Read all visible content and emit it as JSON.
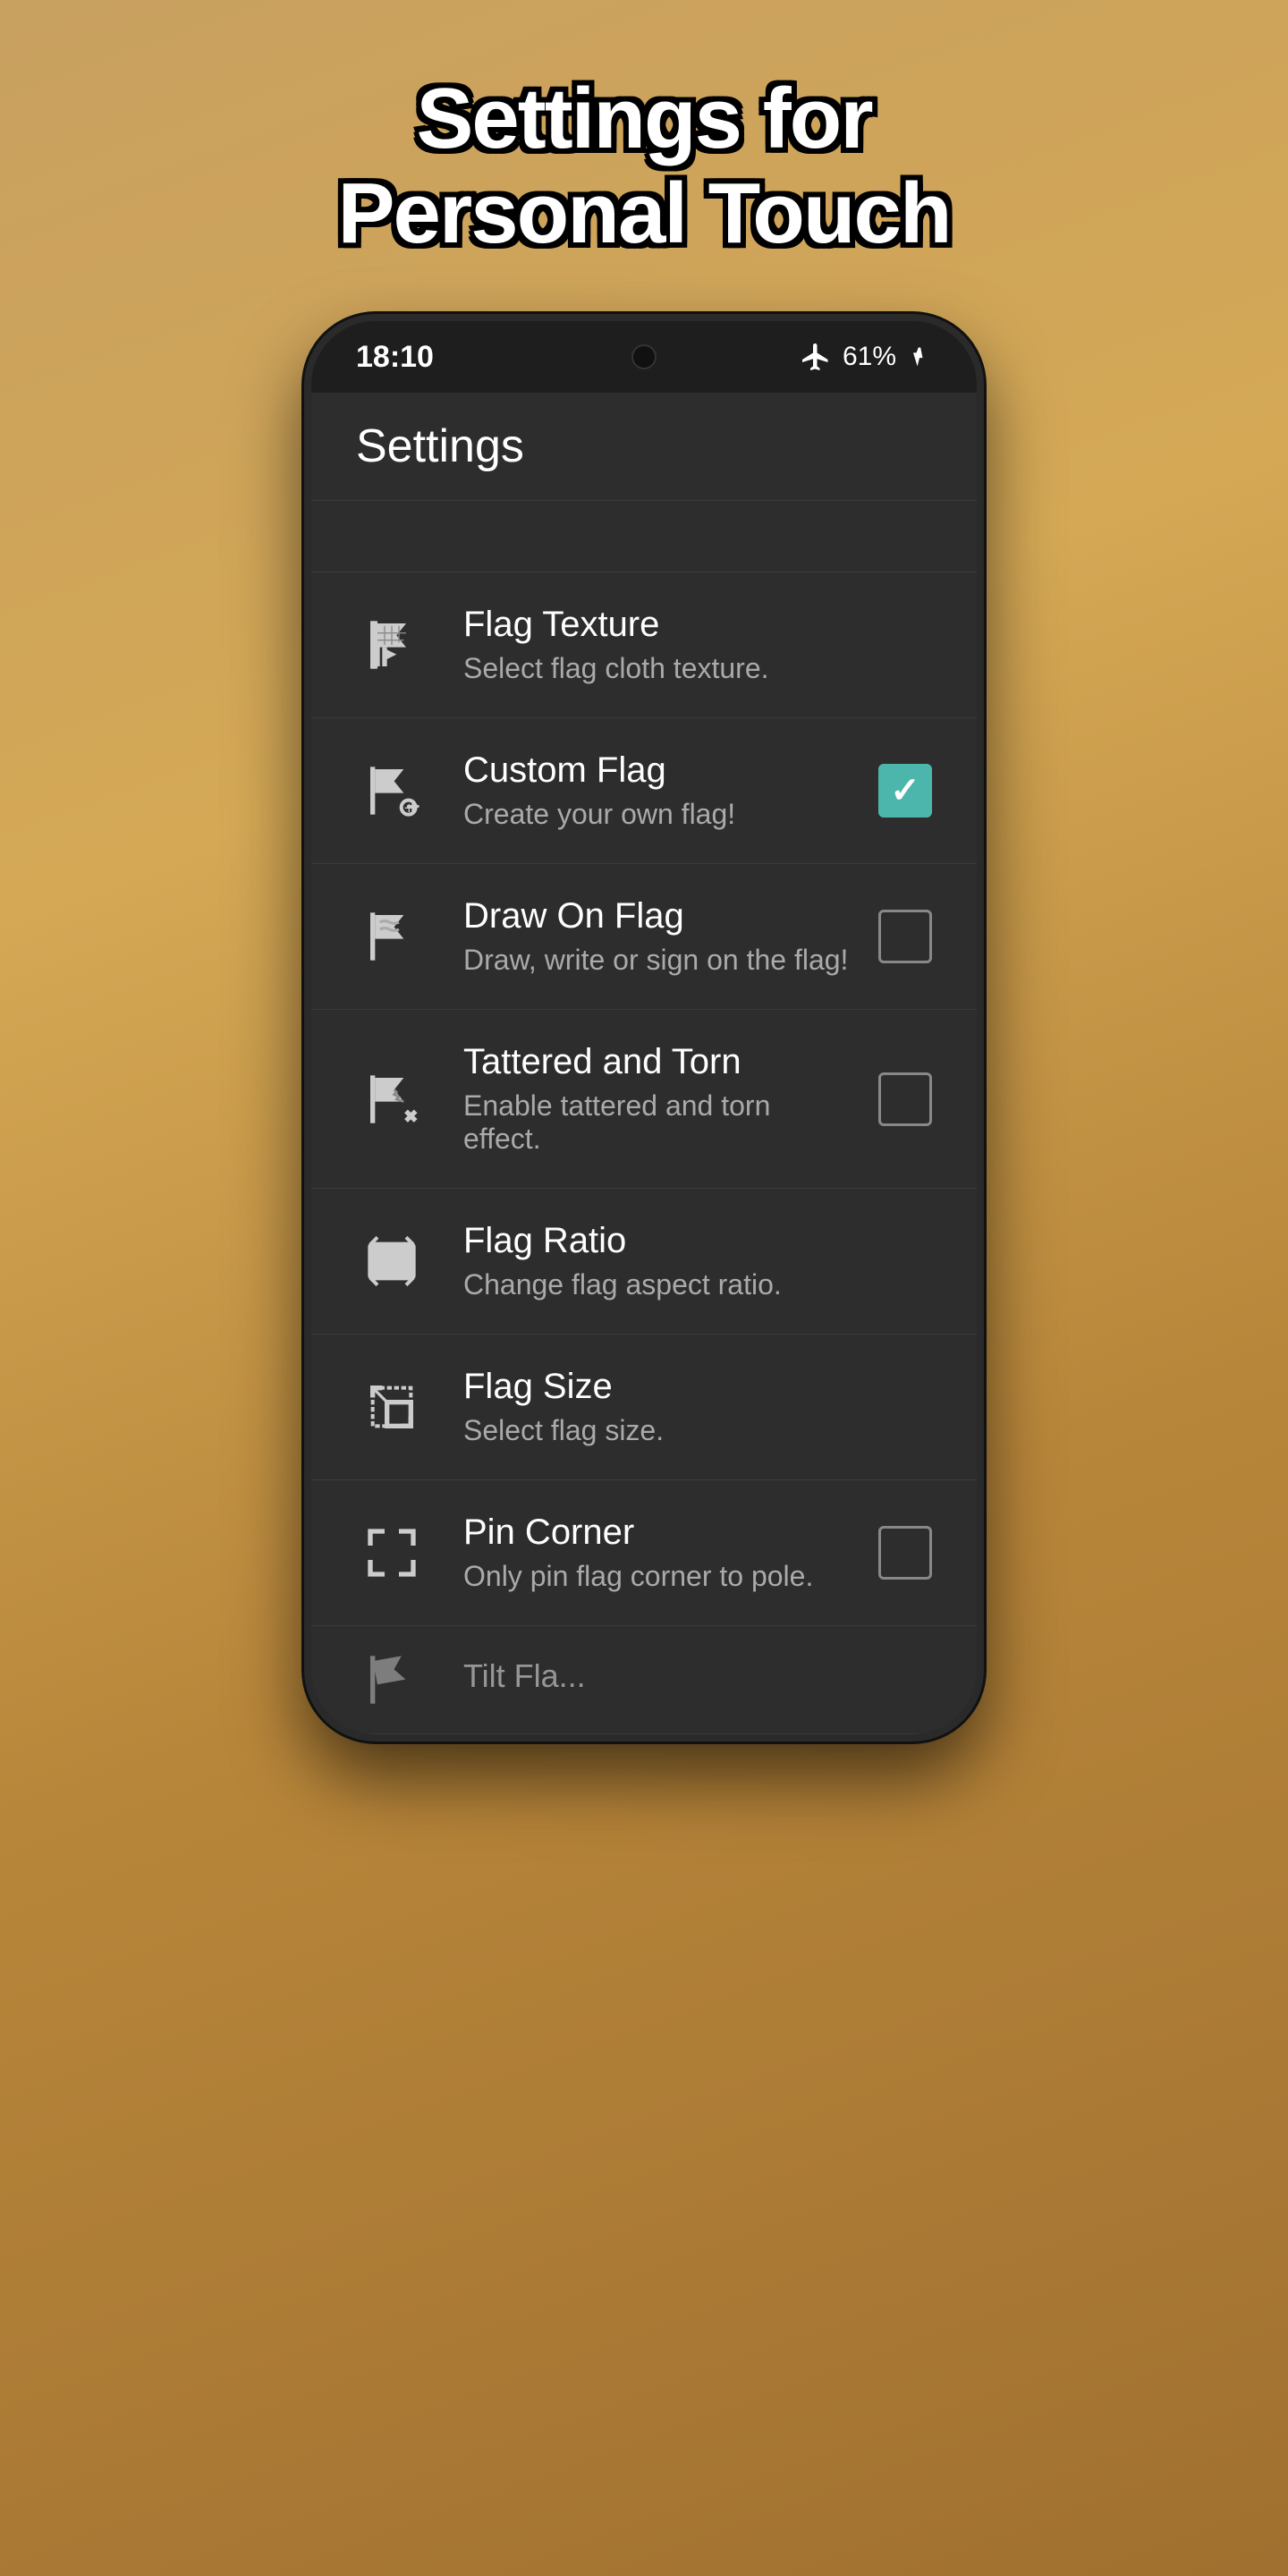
{
  "page": {
    "title_line1": "Settings for",
    "title_line2": "Personal Touch"
  },
  "status_bar": {
    "time": "18:10",
    "battery_percent": "61%",
    "airplane_mode": true
  },
  "app_bar": {
    "title": "Settings"
  },
  "settings": {
    "items": [
      {
        "id": "flag-texture",
        "title": "Flag Texture",
        "subtitle": "Select flag cloth texture.",
        "has_checkbox": false,
        "checked": null,
        "icon": "flag-texture-icon"
      },
      {
        "id": "custom-flag",
        "title": "Custom Flag",
        "subtitle": "Create your own flag!",
        "has_checkbox": true,
        "checked": true,
        "icon": "custom-flag-icon"
      },
      {
        "id": "draw-on-flag",
        "title": "Draw On Flag",
        "subtitle": "Draw, write or sign on the flag!",
        "has_checkbox": true,
        "checked": false,
        "icon": "draw-flag-icon"
      },
      {
        "id": "tattered-torn",
        "title": "Tattered and Torn",
        "subtitle": "Enable tattered and torn effect.",
        "has_checkbox": true,
        "checked": false,
        "icon": "tattered-flag-icon"
      },
      {
        "id": "flag-ratio",
        "title": "Flag Ratio",
        "subtitle": "Change flag aspect ratio.",
        "has_checkbox": false,
        "checked": null,
        "icon": "flag-ratio-icon"
      },
      {
        "id": "flag-size",
        "title": "Flag Size",
        "subtitle": "Select flag size.",
        "has_checkbox": false,
        "checked": null,
        "icon": "flag-size-icon"
      },
      {
        "id": "pin-corner",
        "title": "Pin Corner",
        "subtitle": "Only pin flag corner to pole.",
        "has_checkbox": true,
        "checked": false,
        "icon": "pin-corner-icon"
      }
    ]
  }
}
